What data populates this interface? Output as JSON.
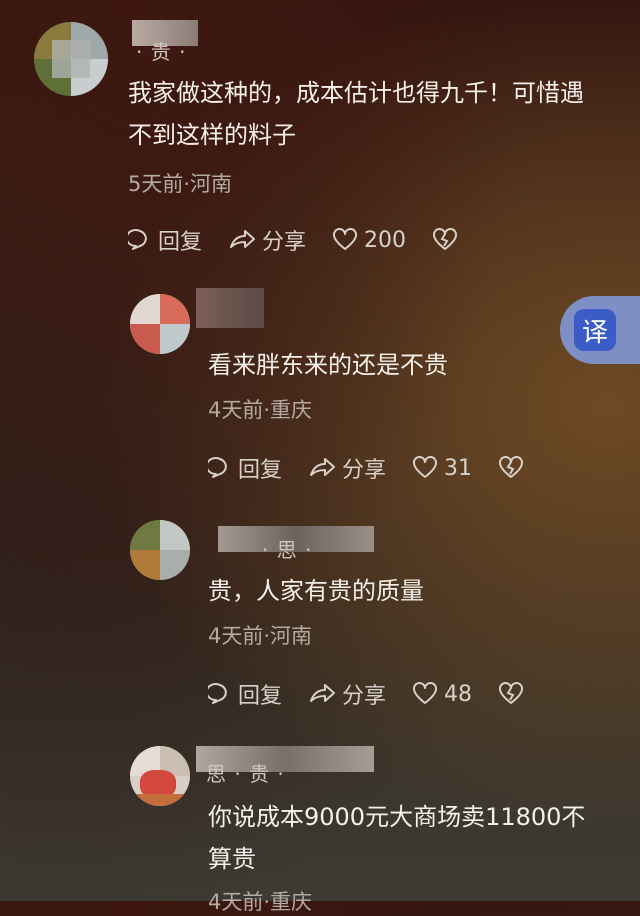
{
  "translate_button": {
    "label": "译"
  },
  "comments": [
    {
      "name_fragment": "· 贵 ·",
      "text_line1": "我家做这种的，成本估计也得九千！可惜遇",
      "text_line2": "不到这样的料子",
      "meta": "5天前·河南",
      "reply_label": "回复",
      "share_label": "分享",
      "likes": "200"
    },
    {
      "name_fragment": "",
      "text_line1": "看来胖东来的还是不贵",
      "meta": "4天前·重庆",
      "reply_label": "回复",
      "share_label": "分享",
      "likes": "31"
    },
    {
      "name_fragment": "· 思 ·",
      "text_line1": "贵，人家有贵的质量",
      "meta": "4天前·河南",
      "reply_label": "回复",
      "share_label": "分享",
      "likes": "48"
    },
    {
      "name_fragment": "思 · 贵 ·",
      "text_line1": "你说成本9000元大商场卖11800不",
      "text_line2": "算贵",
      "meta": "4天前·重庆"
    }
  ]
}
